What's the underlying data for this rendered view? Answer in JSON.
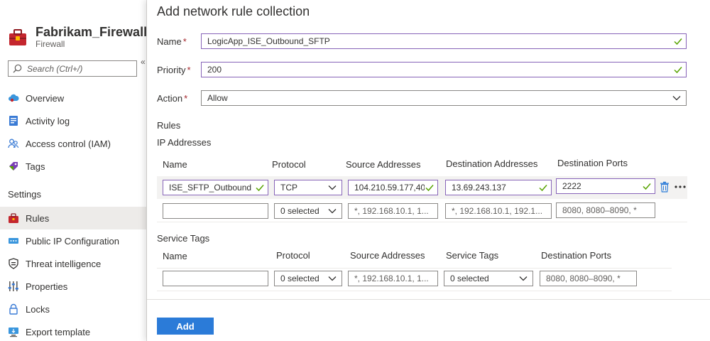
{
  "resource": {
    "title": "Fabrikam_Firewall -",
    "subtitle": "Firewall",
    "collapse_glyph": "«",
    "search_placeholder": "Search (Ctrl+/)"
  },
  "nav": {
    "items": [
      {
        "label": "Overview",
        "icon": "cloud-overview-icon"
      },
      {
        "label": "Activity log",
        "icon": "activity-log-icon"
      },
      {
        "label": "Access control (IAM)",
        "icon": "people-icon"
      },
      {
        "label": "Tags",
        "icon": "tag-icon"
      }
    ],
    "settings_header": "Settings",
    "settings_items": [
      {
        "label": "Rules",
        "icon": "rules-icon",
        "selected": true
      },
      {
        "label": "Public IP Configuration",
        "icon": "public-ip-icon"
      },
      {
        "label": "Threat intelligence",
        "icon": "threat-icon"
      },
      {
        "label": "Properties",
        "icon": "properties-icon"
      },
      {
        "label": "Locks",
        "icon": "lock-icon"
      },
      {
        "label": "Export template",
        "icon": "export-icon"
      }
    ]
  },
  "form": {
    "title": "Add network rule collection",
    "name_label": "Name",
    "name_value": "LogicApp_ISE_Outbound_SFTP",
    "priority_label": "Priority",
    "priority_value": "200",
    "action_label": "Action",
    "action_value": "Allow",
    "required_mark": "*"
  },
  "rules": {
    "header": "Rules",
    "ip": {
      "header": "IP Addresses",
      "columns": [
        "Name",
        "Protocol",
        "Source Addresses",
        "Destination Addresses",
        "Destination Ports"
      ],
      "row1": {
        "name": "ISE_SFTP_Outbound",
        "protocol": "TCP",
        "source": "104.210.59.177,40.",
        "destination": "13.69.243.137",
        "ports": "2222"
      },
      "row2": {
        "name": "",
        "protocol": "0 selected",
        "source_placeholder": "*, 192.168.10.1, 1...",
        "destination_placeholder": "*, 192.168.10.1, 192.1...",
        "ports_placeholder": "8080, 8080–8090, *"
      }
    },
    "tags": {
      "header": "Service Tags",
      "columns": [
        "Name",
        "Protocol",
        "Source Addresses",
        "Service Tags",
        "Destination Ports"
      ],
      "row": {
        "name": "",
        "protocol": "0 selected",
        "source_placeholder": "*, 192.168.10.1, 1...",
        "service_tags": "0 selected",
        "ports_placeholder": "8080, 8080–8090, *"
      }
    }
  },
  "footer": {
    "add_label": "Add"
  },
  "colors": {
    "accent": "#2b7bd8",
    "valid_border": "#8764b8",
    "valid_check": "#57a300",
    "required": "#a4262c"
  }
}
